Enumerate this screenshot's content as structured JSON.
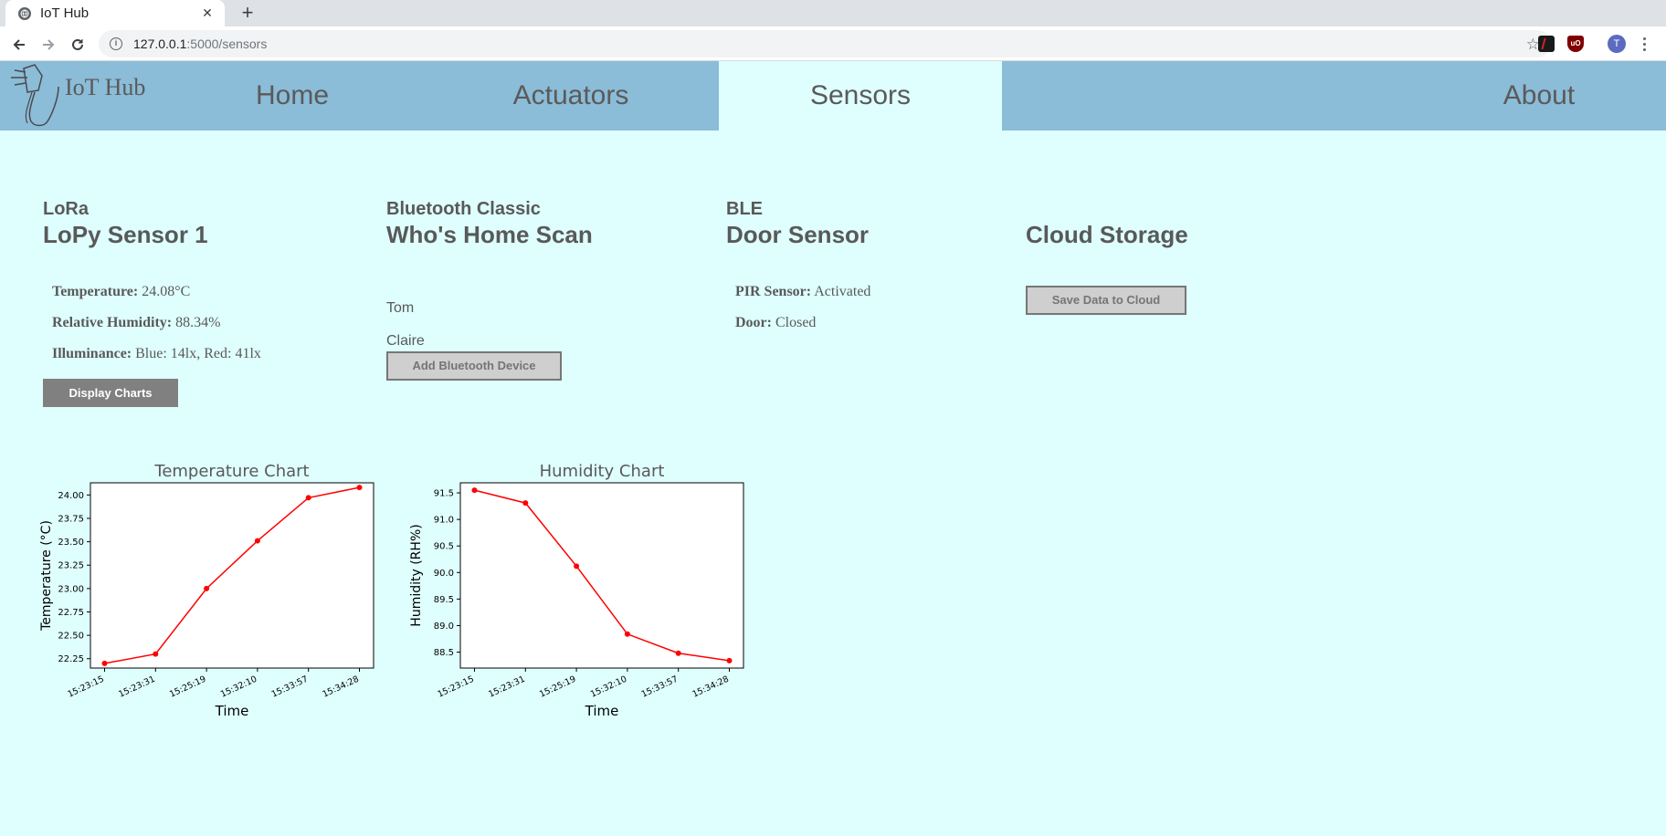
{
  "browser": {
    "tab_title": "IoT Hub",
    "tab_close": "✕",
    "new_tab": "+",
    "url_host": "127.0.0.1",
    "url_path": ":5000/sensors",
    "avatar_letter": "T",
    "star": "☆"
  },
  "nav": {
    "logo_text": "IoT Hub",
    "items": [
      "Home",
      "Actuators",
      "Sensors",
      "About"
    ],
    "active": "Sensors"
  },
  "lora": {
    "protocol": "LoRa",
    "title": "LoPy Sensor 1",
    "temperature_label": "Temperature:",
    "temperature_value": "24.08°C",
    "humidity_label": "Relative Humidity:",
    "humidity_value": "88.34%",
    "illuminance_label": "Illuminance:",
    "illuminance_value": "Blue: 14lx, Red: 41lx",
    "display_charts_button": "Display Charts"
  },
  "bluetooth": {
    "protocol": "Bluetooth Classic",
    "title": "Who's Home Scan",
    "people": [
      "Tom",
      "Claire"
    ],
    "add_button": "Add Bluetooth Device"
  },
  "ble": {
    "protocol": "BLE",
    "title": "Door Sensor",
    "pir_label": "PIR Sensor:",
    "pir_value": "Activated",
    "door_label": "Door:",
    "door_value": "Closed"
  },
  "cloud": {
    "title": "Cloud Storage",
    "save_button": "Save Data to Cloud"
  },
  "colors": {
    "page_bg": "#dfffff",
    "navbar_bg": "#8bbcd8",
    "line": "#ff0000"
  },
  "chart_data": [
    {
      "type": "line",
      "title": "Temperature Chart",
      "xlabel": "Time",
      "ylabel": "Temperature (°C)",
      "x": [
        "15:23:15",
        "15:23:31",
        "15:25:19",
        "15:32:10",
        "15:33:57",
        "15:34:28"
      ],
      "values": [
        22.2,
        22.3,
        23.0,
        23.51,
        23.97,
        24.08
      ],
      "ylim": [
        22.15,
        24.13
      ],
      "yticks": [
        "22.25",
        "22.50",
        "22.75",
        "23.00",
        "23.25",
        "23.50",
        "23.75",
        "24.00"
      ],
      "grid": false
    },
    {
      "type": "line",
      "title": "Humidity Chart",
      "xlabel": "Time",
      "ylabel": "Humidity (RH%)",
      "x": [
        "15:23:15",
        "15:23:31",
        "15:25:19",
        "15:32:10",
        "15:33:57",
        "15:34:28"
      ],
      "values": [
        91.55,
        91.31,
        90.12,
        88.84,
        88.48,
        88.34
      ],
      "ylim": [
        88.2,
        91.69
      ],
      "yticks": [
        "88.5",
        "89.0",
        "89.5",
        "90.0",
        "90.5",
        "91.0",
        "91.5"
      ],
      "grid": false
    }
  ]
}
